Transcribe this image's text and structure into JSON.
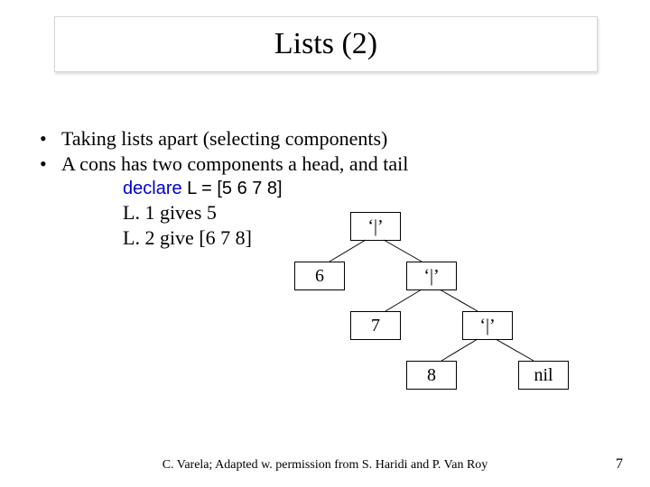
{
  "title": "Lists (2)",
  "bullets": {
    "b1": "Taking lists apart (selecting components)",
    "b2": "A cons has two components a head, and tail"
  },
  "code": {
    "kw": "declare",
    "rest": "  L = [5 6 7 8]",
    "line2": "L. 1 gives 5",
    "line3": "L. 2 give [6 7 8]"
  },
  "tree": {
    "cons": "‘|’",
    "n6": "6",
    "n7": "7",
    "n8": "8",
    "nil": "nil"
  },
  "footer": "C. Varela;  Adapted w. permission from S. Haridi and P. Van Roy",
  "page": "7"
}
